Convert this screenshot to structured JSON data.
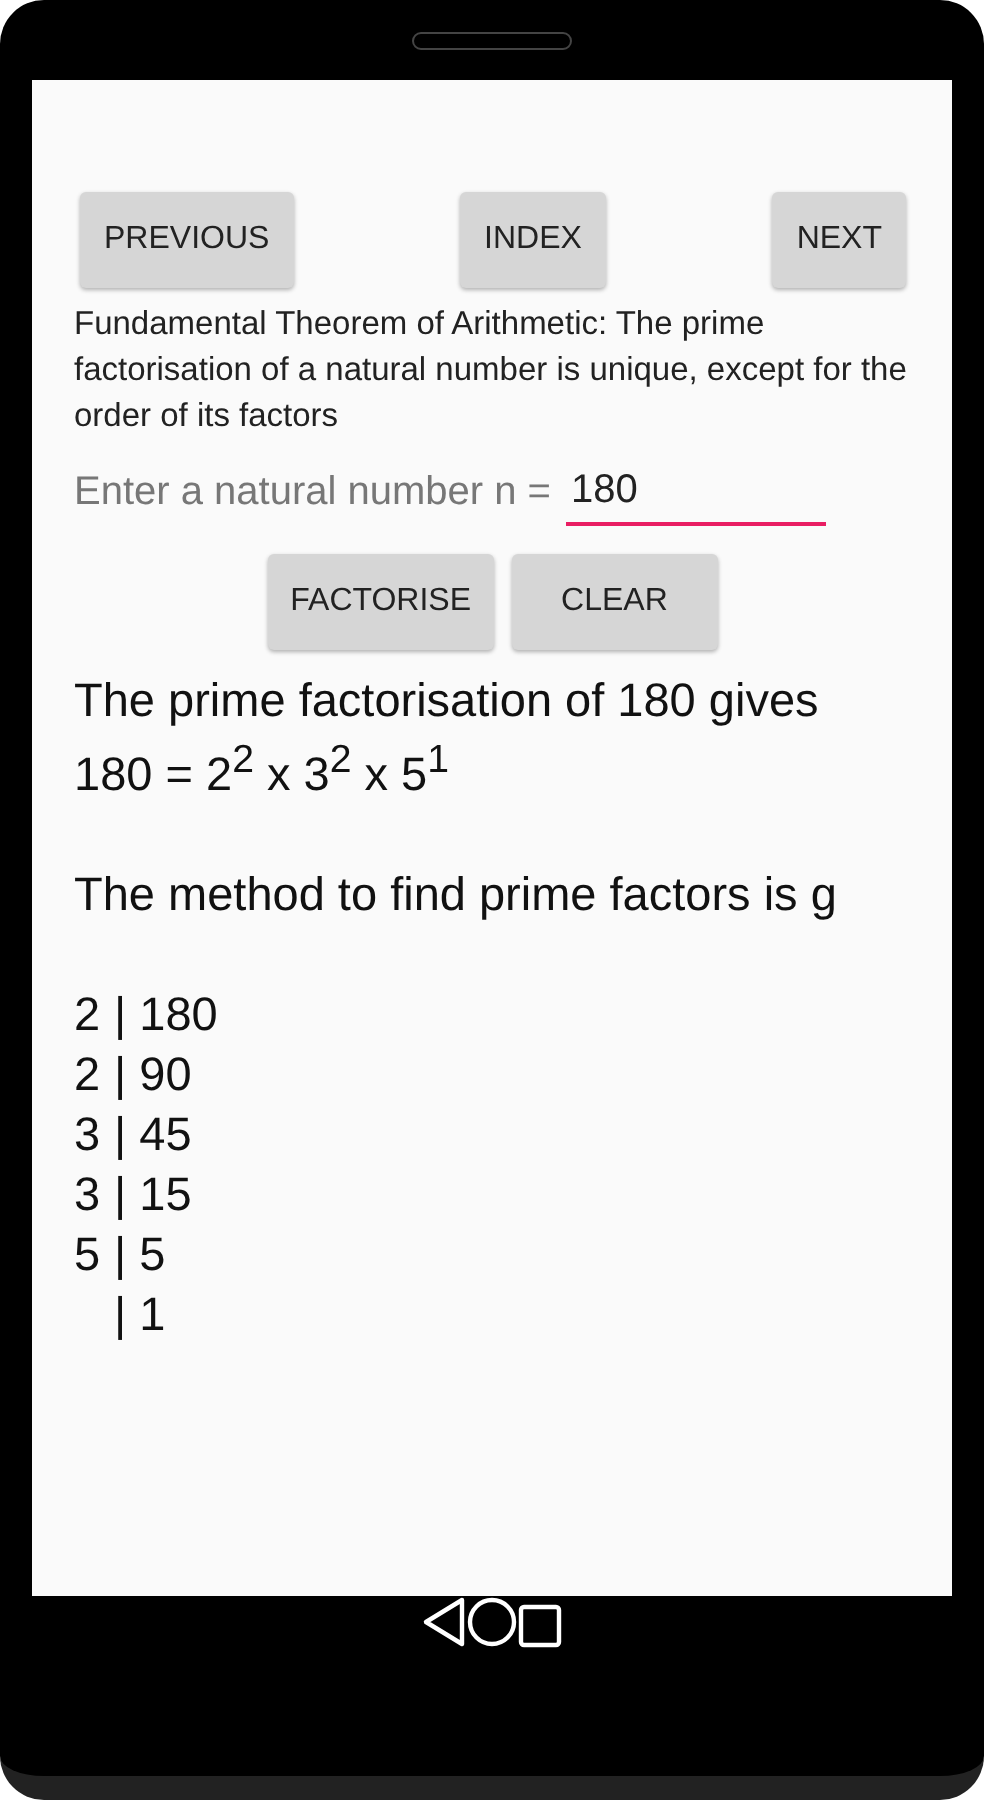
{
  "nav_buttons": [
    {
      "label": "PREVIOUS"
    },
    {
      "label": "INDEX"
    },
    {
      "label": "NEXT"
    }
  ],
  "description": "Fundamental Theorem of Arithmetic: The prime factorisation of a natural number is unique, except for the order of its factors",
  "input": {
    "label": "Enter a natural number n =",
    "value": "180"
  },
  "action_buttons": [
    {
      "label": "FACTORISE"
    },
    {
      "label": "CLEAR"
    }
  ],
  "result_lines": [
    "The prime factorisation of 180 gives",
    "180 = 2$^{2}$ x 3$^{2}$ x 5$^{1}$"
  ],
  "method_line": "The method to find prime factors is g",
  "division_steps": [
    {
      "divisor": "2",
      "quotient": "| 180"
    },
    {
      "divisor": "2",
      "quotient": "| 90"
    },
    {
      "divisor": "3",
      "quotient": "| 45"
    },
    {
      "divisor": "3",
      "quotient": "| 15"
    },
    {
      "divisor": "5",
      "quotient": "| 5"
    },
    {
      "quotient": "| 1"
    }
  ]
}
